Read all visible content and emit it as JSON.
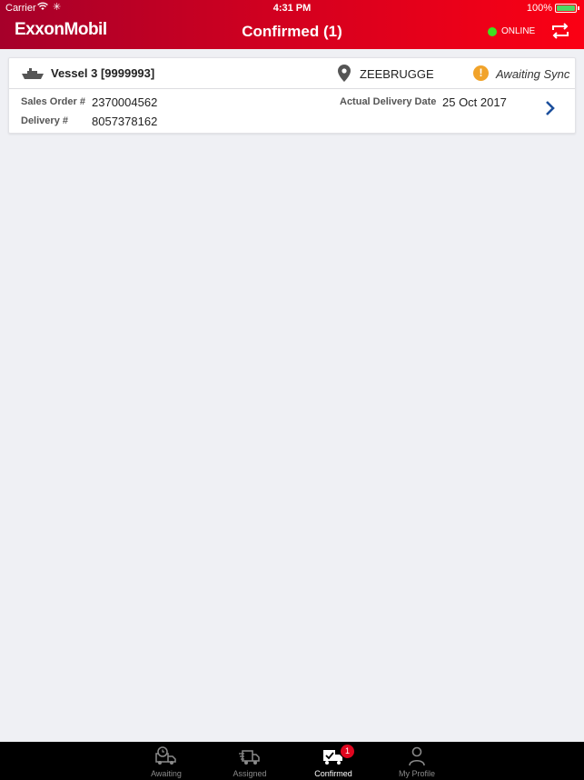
{
  "status_bar": {
    "carrier": "Carrier",
    "time": "4:31 PM",
    "battery": "100%"
  },
  "header": {
    "logo": "ExxonMobil",
    "title": "Confirmed (1)",
    "connection_status": "ONLINE",
    "connection_color": "#3ee021"
  },
  "orders": [
    {
      "vessel": "Vessel 3 [9999993]",
      "port": "ZEEBRUGGE",
      "sync_status": "Awaiting Sync",
      "sales_order_label": "Sales Order #",
      "sales_order": "2370004562",
      "delivery_label": "Delivery #",
      "delivery": "8057378162",
      "delivery_date_label": "Actual Delivery Date",
      "delivery_date": "25 Oct 2017"
    }
  ],
  "tabs": [
    {
      "label": "Awaiting",
      "icon": "truck-clock-icon"
    },
    {
      "label": "Assigned",
      "icon": "truck-list-icon"
    },
    {
      "label": "Confirmed",
      "icon": "truck-check-icon",
      "badge": "1",
      "active": true
    },
    {
      "label": "My Profile",
      "icon": "person-icon"
    }
  ],
  "colors": {
    "brand_red": "#d4001f",
    "accent_blue": "#1c4f9c",
    "warning": "#f1a32a"
  }
}
